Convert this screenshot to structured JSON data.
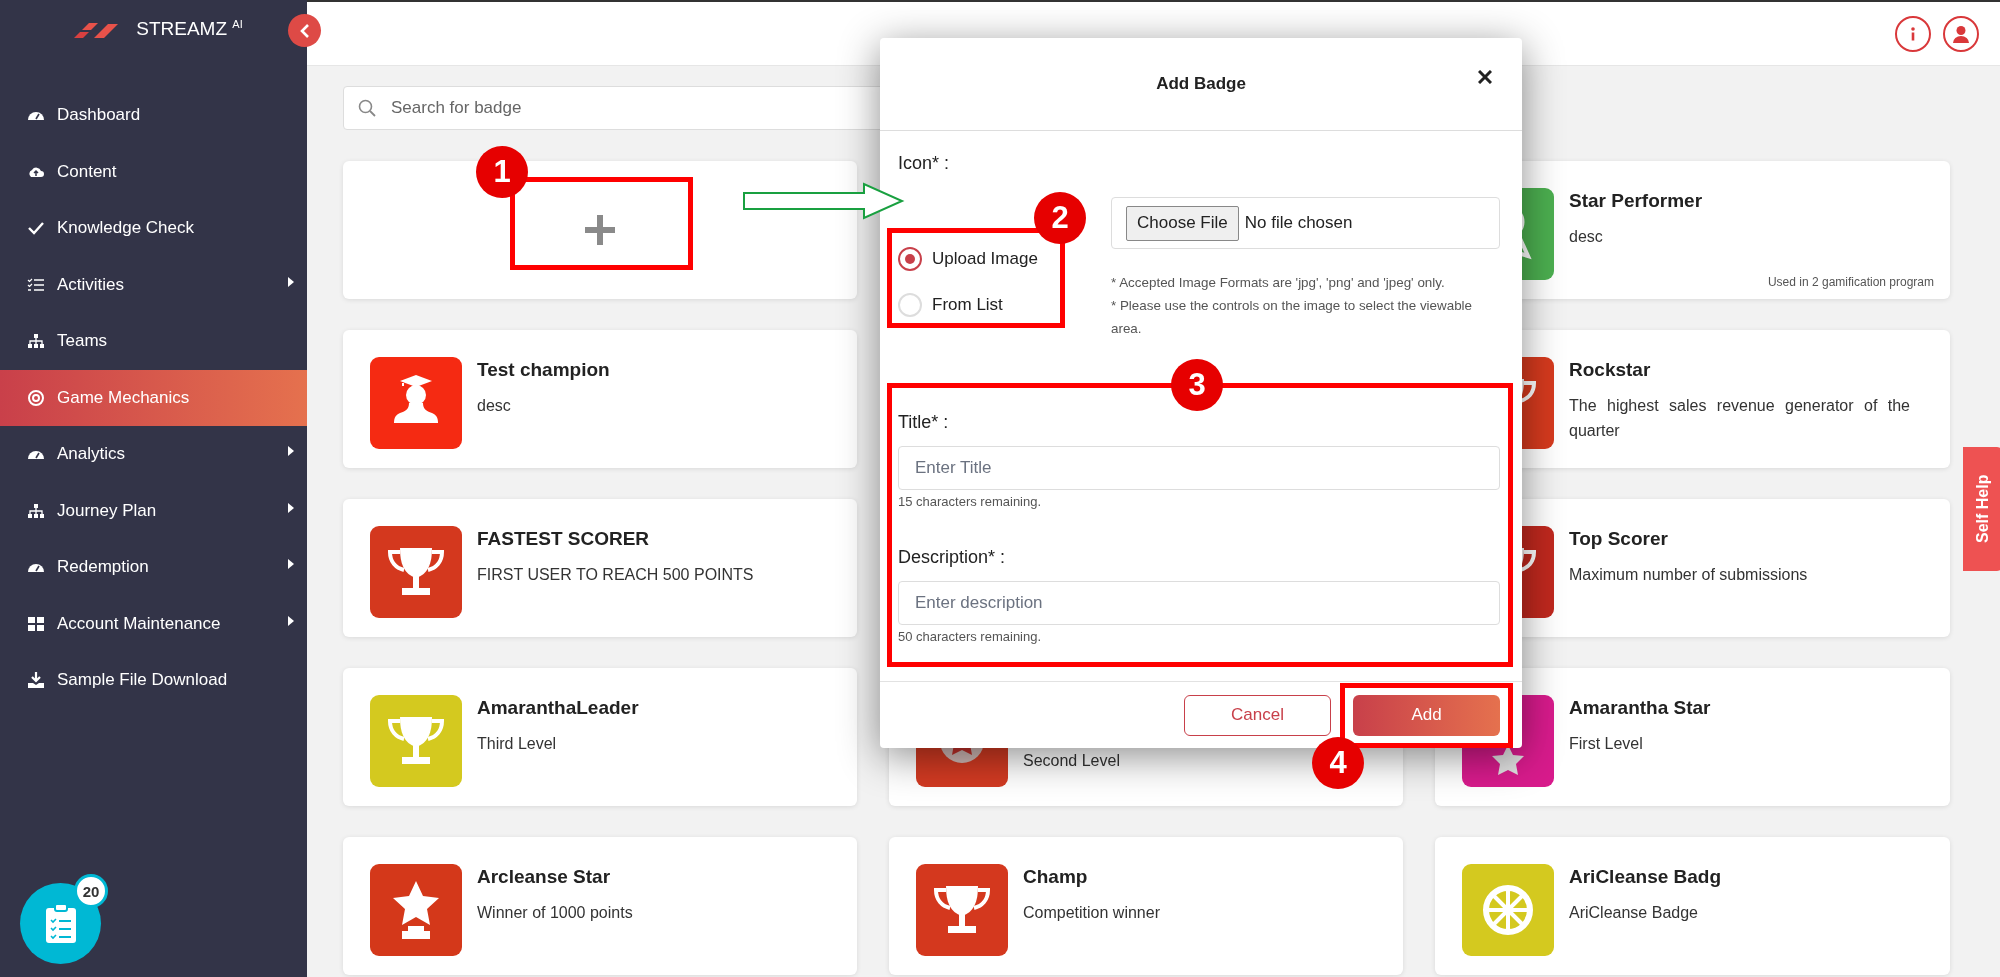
{
  "sidebar": {
    "brand": "STREAMZ $^{AI}$",
    "items": [
      {
        "label": "Dashboard",
        "selected": false,
        "submenu": false
      },
      {
        "label": "Content",
        "selected": false,
        "submenu": false
      },
      {
        "label": "Knowledge Check",
        "selected": false,
        "submenu": false
      },
      {
        "label": "Activities",
        "selected": false,
        "submenu": true
      },
      {
        "label": "Teams",
        "selected": false,
        "submenu": false
      },
      {
        "label": "Game Mechanics",
        "selected": true,
        "submenu": false
      },
      {
        "label": "Analytics",
        "selected": false,
        "submenu": true
      },
      {
        "label": "Journey Plan",
        "selected": false,
        "submenu": true
      },
      {
        "label": "Redemption",
        "selected": false,
        "submenu": true
      },
      {
        "label": "Account Maintenance",
        "selected": false,
        "submenu": true
      },
      {
        "label": "Sample File Download",
        "selected": false,
        "submenu": false
      }
    ]
  },
  "search": {
    "placeholder": "Search for badge"
  },
  "badge_cards": [
    {
      "title": "Star Performer",
      "description": "desc",
      "usage": "Used in 2 gamification program",
      "color": "#4caf50"
    },
    {
      "title": "Test champion",
      "description": "desc",
      "color": "#f52a12"
    },
    {
      "title": "Rockstar",
      "description": "The highest sales revenue generator of the quarter",
      "color": "#d63a1e"
    },
    {
      "title": "FASTEST SCORER",
      "description": "FIRST USER TO REACH 500 POINTS",
      "color": "#d4381e"
    },
    {
      "title": "Top Scorer",
      "description": "Maximum number of submissions",
      "color": "#c0281e"
    },
    {
      "title": "AmaranthaLeader",
      "description": "Third Level",
      "color": "#d4c91f"
    },
    {
      "description": "Second Level",
      "color": "#d23a22"
    },
    {
      "title": "Amarantha Star",
      "description": "First Level",
      "color": "#d81b8c"
    },
    {
      "title": "Arcleanse Star",
      "description": "Winner of 1000 points",
      "color": "#d4381a"
    },
    {
      "title": "Champ",
      "description": "Competition winner",
      "color": "#d4381e"
    },
    {
      "title": "AriCleanse Badg",
      "description": "AriCleanse Badge",
      "color": "#d4c91f"
    }
  ],
  "modal": {
    "title": "Add Badge",
    "icon_label": "Icon* :",
    "icon_source": [
      {
        "label": "Upload Image",
        "selected": true
      },
      {
        "label": "From List",
        "selected": false
      }
    ],
    "file_button": "Choose File",
    "file_status": "No file chosen",
    "hints": [
      "* Accepted Image Formats are 'jpg', 'png' and 'jpeg' only.",
      "* Please use the controls on the image to select the viewable area."
    ],
    "fields": [
      {
        "label": "Title* :",
        "placeholder": "Enter Title",
        "counter": "15 characters remaining."
      },
      {
        "label": "Description* :",
        "placeholder": "Enter description",
        "counter": "50 characters remaining."
      }
    ],
    "buttons": [
      {
        "label": "Cancel",
        "kind": "secondary"
      },
      {
        "label": "Add",
        "kind": "primary"
      }
    ]
  },
  "annotations": [
    {
      "number": "1"
    },
    {
      "number": "2"
    },
    {
      "number": "3"
    },
    {
      "number": "4"
    }
  ],
  "self_help": "Self Help",
  "tasks": {
    "count": "20"
  }
}
